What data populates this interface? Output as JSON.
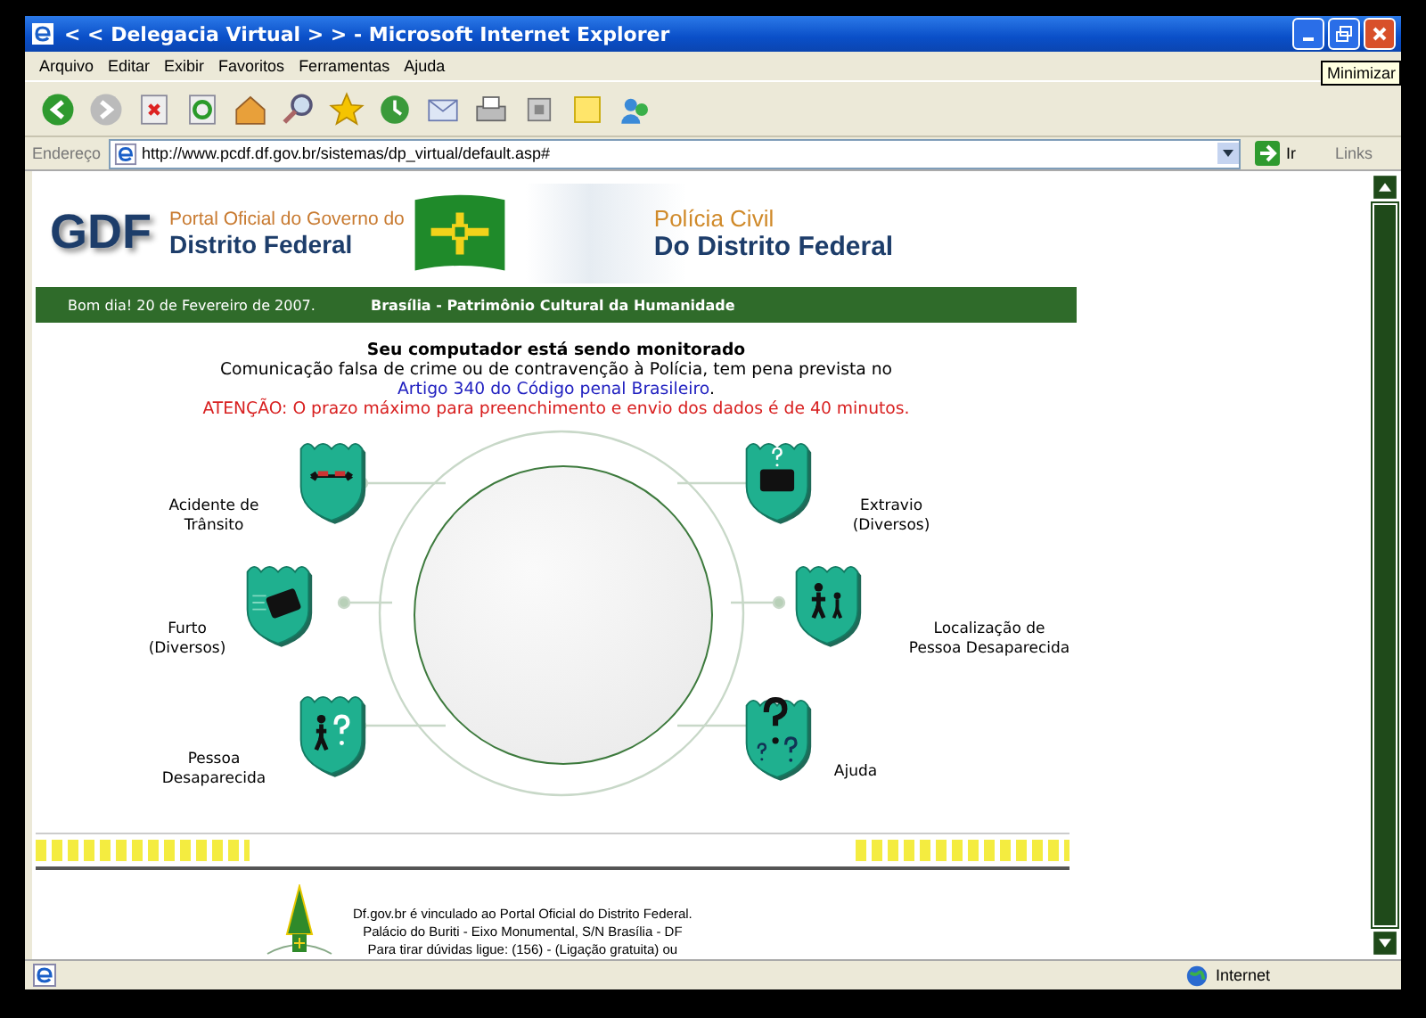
{
  "window": {
    "title": "< < Delegacia Virtual > > - Microsoft Internet Explorer",
    "tooltip": "Minimizar"
  },
  "menu": [
    "Arquivo",
    "Editar",
    "Exibir",
    "Favoritos",
    "Ferramentas",
    "Ajuda"
  ],
  "address": {
    "label": "Endereço",
    "url": "http://www.pcdf.df.gov.br/sistemas/dp_virtual/default.asp#",
    "go": "Ir",
    "links": "Links"
  },
  "header": {
    "gdf": "GDF",
    "portal_line1": "Portal Oficial do Governo do",
    "portal_line2": "Distrito Federal",
    "policia_line1": "Polícia Civil",
    "policia_line2": "Do Distrito Federal"
  },
  "green_bar": {
    "greeting": "Bom dia! 20 de Fevereiro de 2007.",
    "motto": "Brasília - Patrimônio Cultural da Humanidade"
  },
  "notice": {
    "heading": "Seu computador está sendo monitorado",
    "text": "Comunicação falsa de crime ou de contravenção à Polícia, tem pena prevista no",
    "link": "Artigo 340 do Código penal Brasileiro",
    "link_after": ".",
    "warning": "ATENÇÃO: O prazo máximo para preenchimento e envio dos dados é de 40 minutos."
  },
  "services": [
    {
      "kind": "car",
      "lines": [
        "Acidente de",
        "Trânsito"
      ]
    },
    {
      "kind": "bag",
      "lines": [
        "Extravio",
        "(Diversos)"
      ]
    },
    {
      "kind": "theft",
      "lines": [
        "Furto",
        "(Diversos)"
      ]
    },
    {
      "kind": "children",
      "lines": [
        "Localização de",
        "Pessoa Desaparecida"
      ]
    },
    {
      "kind": "person",
      "lines": [
        "Pessoa",
        "Desaparecida"
      ]
    },
    {
      "kind": "help",
      "lines": [
        "Ajuda"
      ]
    }
  ],
  "footer": [
    "Df.gov.br é vinculado ao Portal Oficial do  Distrito Federal.",
    "Palácio do Buriti - Eixo Monumental, S/N Brasília - DF",
    "Para tirar dúvidas ligue: (156) - (Ligação gratuita) ou"
  ],
  "status": {
    "zone": "Internet"
  }
}
